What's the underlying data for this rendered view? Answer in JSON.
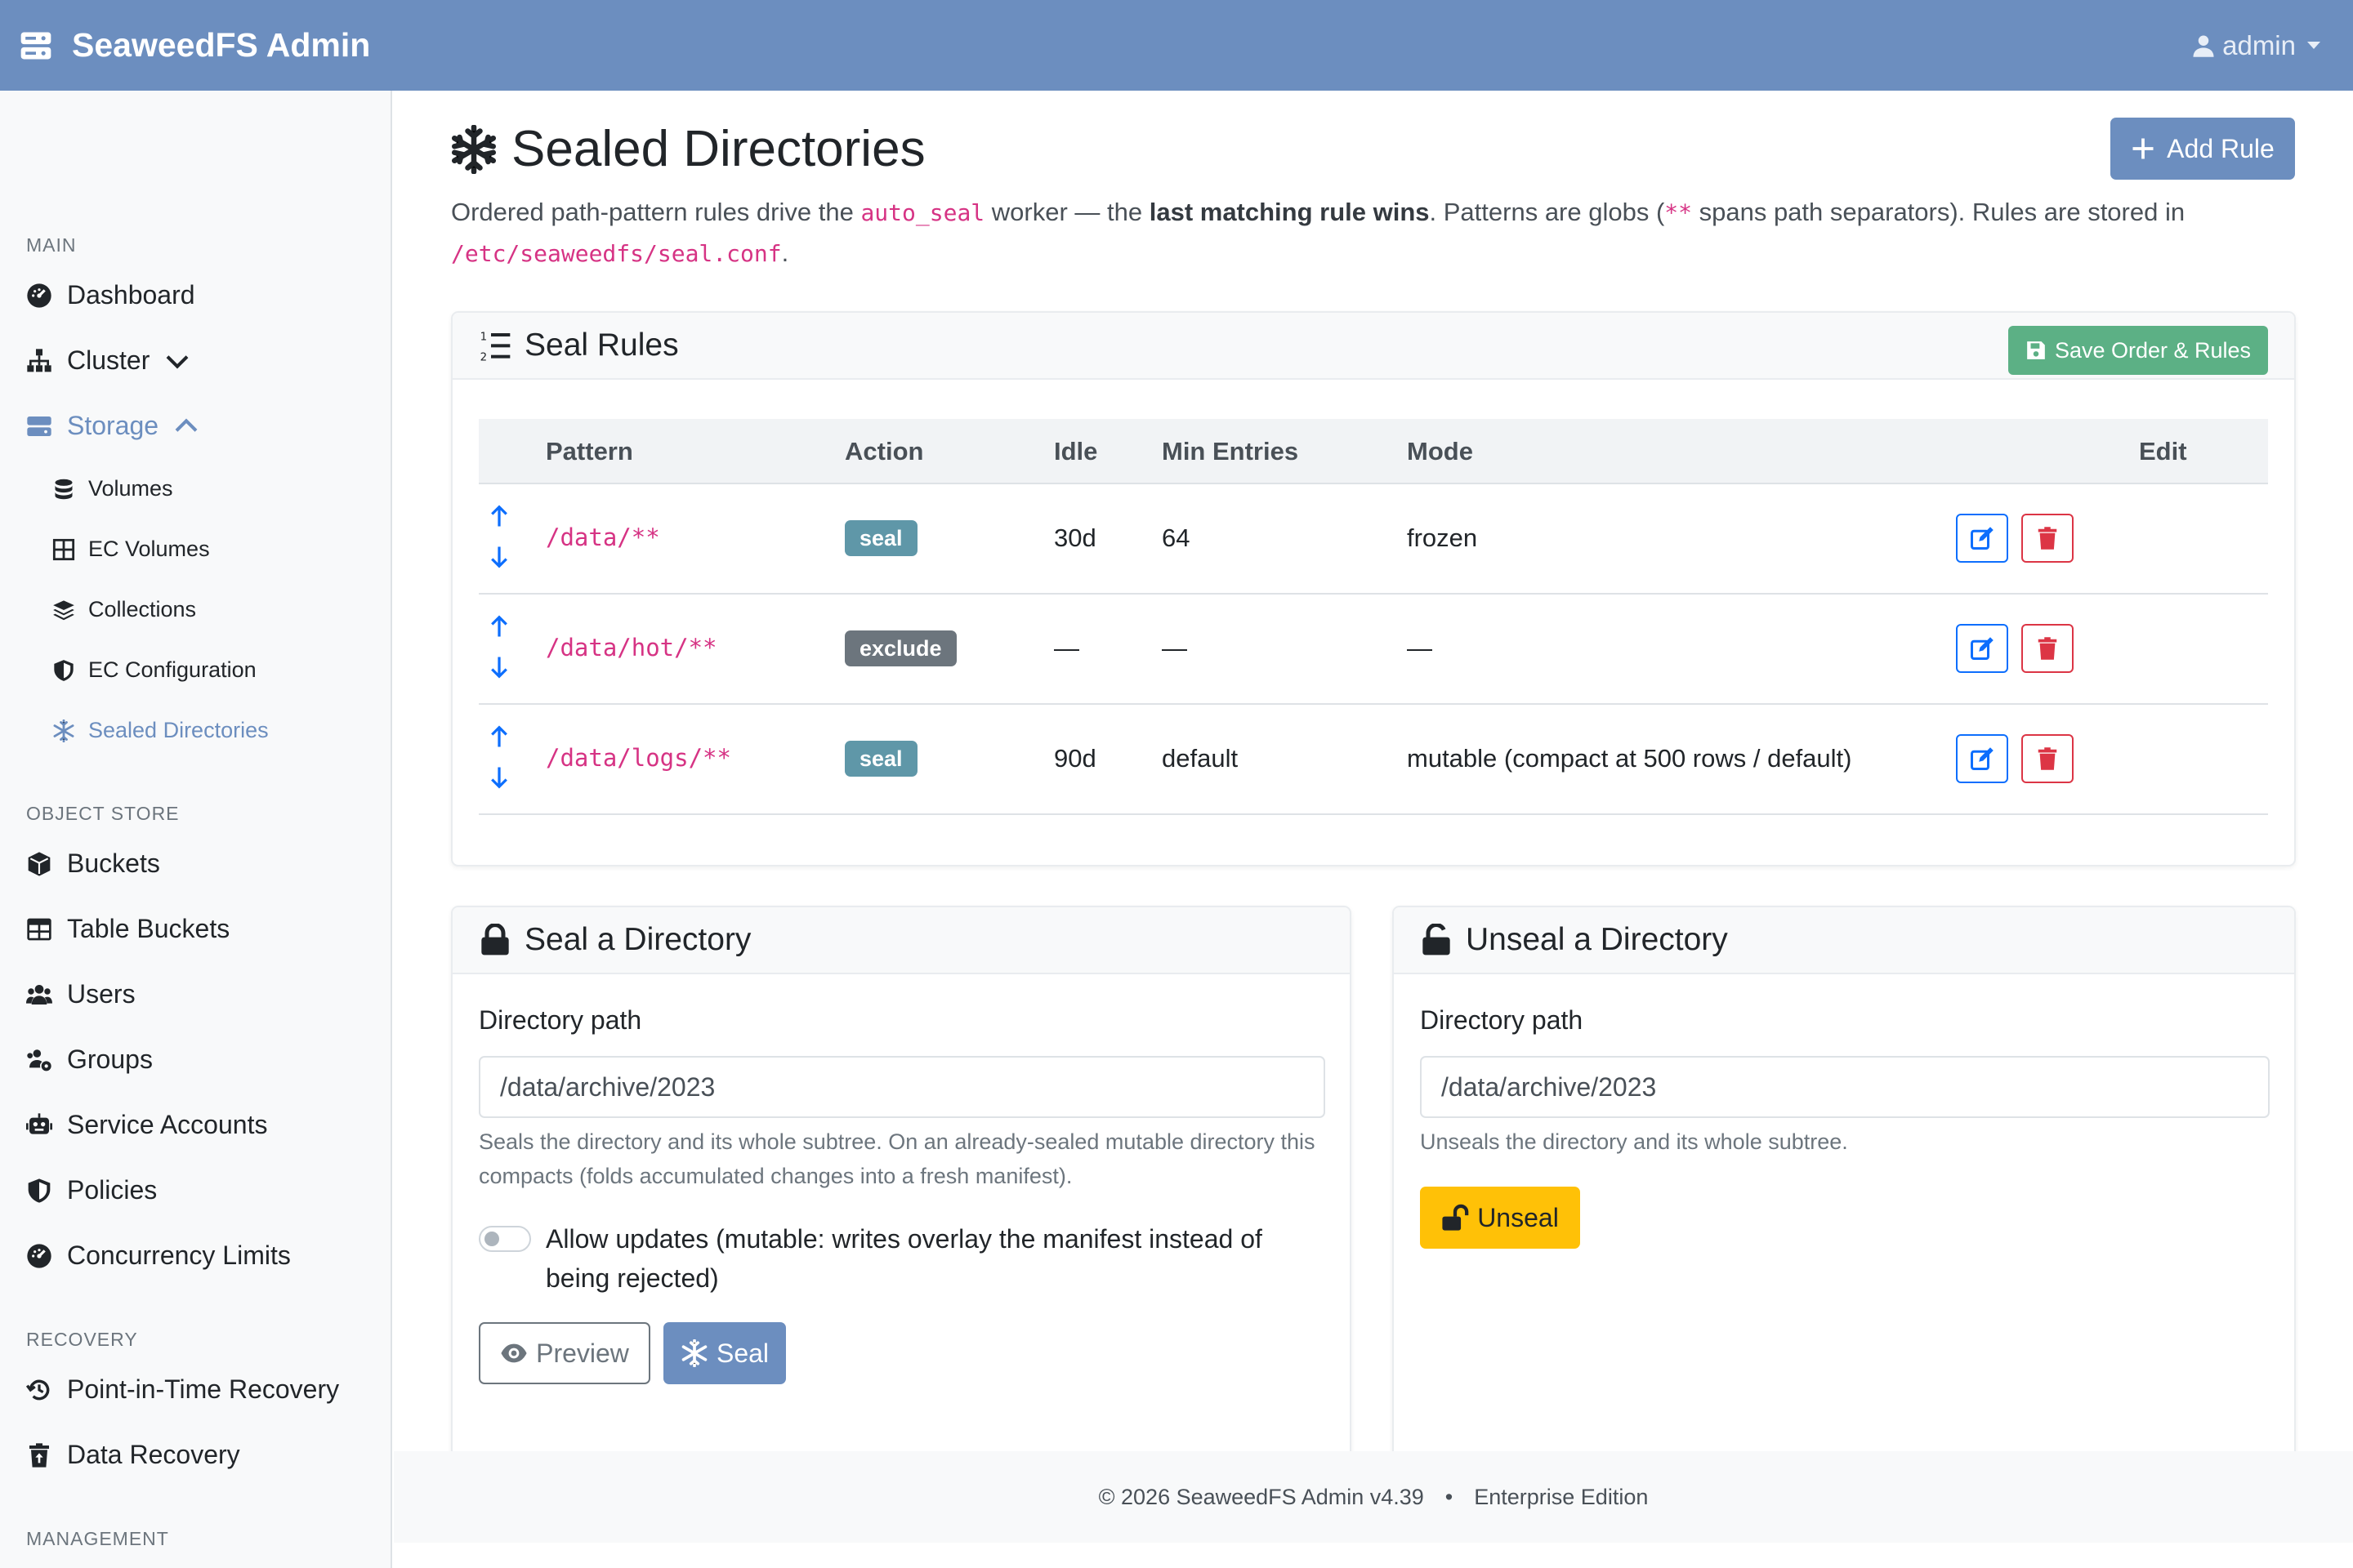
{
  "navbar": {
    "brand": "SeaweedFS Admin",
    "user": "admin"
  },
  "sidebar": {
    "sections": {
      "main": "MAIN",
      "object_store": "OBJECT STORE",
      "recovery": "RECOVERY",
      "management": "MANAGEMENT"
    },
    "items": {
      "dashboard": "Dashboard",
      "cluster": "Cluster",
      "storage": "Storage",
      "volumes": "Volumes",
      "ec_volumes": "EC Volumes",
      "collections": "Collections",
      "ec_configuration": "EC Configuration",
      "sealed_directories": "Sealed Directories",
      "buckets": "Buckets",
      "table_buckets": "Table Buckets",
      "users": "Users",
      "groups": "Groups",
      "service_accounts": "Service Accounts",
      "policies": "Policies",
      "concurrency_limits": "Concurrency Limits",
      "pitr": "Point-in-Time Recovery",
      "data_recovery": "Data Recovery"
    },
    "colors": {
      "active": "#6c8ebf"
    }
  },
  "page": {
    "title": "Sealed Directories",
    "add_rule": "Add Rule",
    "intro": {
      "p1": "Ordered path-pattern rules drive the ",
      "code1": "auto_seal",
      "p2": " worker — the ",
      "bold": "last matching rule wins",
      "p3": ". Patterns are globs (",
      "code2": "**",
      "p4": " spans path separators). Rules are stored in ",
      "code3": "/etc/seaweedfs/seal.conf",
      "p5": "."
    }
  },
  "rules_card": {
    "title": "Seal Rules",
    "save_label": "Save Order & Rules",
    "columns": {
      "pattern": "Pattern",
      "action": "Action",
      "idle": "Idle",
      "min_entries": "Min Entries",
      "mode": "Mode",
      "edit": "Edit"
    },
    "rows": [
      {
        "pattern": "/data/**",
        "action": "seal",
        "idle": "30d",
        "min_entries": "64",
        "mode": "frozen"
      },
      {
        "pattern": "/data/hot/**",
        "action": "exclude",
        "idle": "—",
        "min_entries": "—",
        "mode": "—"
      },
      {
        "pattern": "/data/logs/**",
        "action": "seal",
        "idle": "90d",
        "min_entries": "default",
        "mode": "mutable (compact at 500 rows / default)"
      }
    ]
  },
  "seal_card": {
    "title": "Seal a Directory",
    "label": "Directory path",
    "value": "/data/archive/2023",
    "help": "Seals the directory and its whole subtree. On an already-sealed mutable directory this compacts (folds accumulated changes into a fresh manifest).",
    "switch_label": "Allow updates (mutable: writes overlay the manifest instead of being rejected)",
    "preview": "Preview",
    "seal": "Seal"
  },
  "unseal_card": {
    "title": "Unseal a Directory",
    "label": "Directory path",
    "value": "/data/archive/2023",
    "help": "Unseals the directory and its whole subtree.",
    "unseal": "Unseal"
  },
  "footer": {
    "copyright": "© 2026 SeaweedFS Admin v4.39",
    "separator": "•",
    "edition": "Enterprise Edition"
  }
}
